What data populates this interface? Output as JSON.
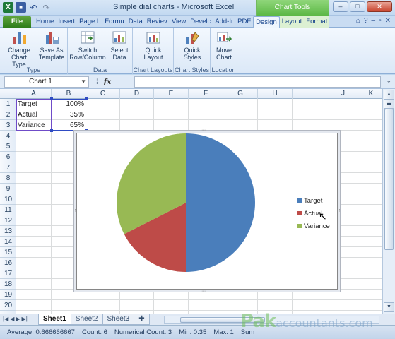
{
  "window": {
    "title": "Simple dial charts - Microsoft Excel",
    "context_tab": "Chart Tools",
    "minimize": "–",
    "maximize": "□",
    "close": "✕"
  },
  "qat": {
    "logo": "X",
    "save": "■",
    "undo": "↶",
    "redo": "↷"
  },
  "ribbon_tabs": [
    {
      "label": "File"
    },
    {
      "label": "Home"
    },
    {
      "label": "Insert"
    },
    {
      "label": "Page L"
    },
    {
      "label": "Formu"
    },
    {
      "label": "Data"
    },
    {
      "label": "Reviev"
    },
    {
      "label": "View"
    },
    {
      "label": "Develc"
    },
    {
      "label": "Add-Ir"
    },
    {
      "label": "PDF"
    },
    {
      "label": "Design"
    },
    {
      "label": "Layout"
    },
    {
      "label": "Format"
    }
  ],
  "ribbon_groups": {
    "type": {
      "label": "Type",
      "change_chart_type": "Change Chart Type",
      "save_as_template": "Save As Template"
    },
    "data": {
      "label": "Data",
      "switch_row_column": "Switch Row/Column",
      "select_data": "Select Data"
    },
    "chart_layouts": {
      "label": "Chart Layouts",
      "quick_layout": "Quick Layout"
    },
    "chart_styles": {
      "label": "Chart Styles",
      "quick_styles": "Quick Styles"
    },
    "location": {
      "label": "Location",
      "move_chart": "Move Chart"
    }
  },
  "formula_bar": {
    "name_box": "Chart 1",
    "fx": "fx",
    "formula": ""
  },
  "columns": [
    "A",
    "B",
    "C",
    "D",
    "E",
    "F",
    "G",
    "H",
    "I",
    "J",
    "K"
  ],
  "rows": [
    "1",
    "2",
    "3",
    "4",
    "5",
    "6",
    "7",
    "8",
    "9",
    "10",
    "11",
    "12",
    "13",
    "14",
    "15",
    "16",
    "17",
    "18",
    "19",
    "20"
  ],
  "cells": [
    {
      "label": "Target",
      "value": "100%"
    },
    {
      "label": "Actual",
      "value": "35%"
    },
    {
      "label": "Variance",
      "value": "65%"
    }
  ],
  "chart_data": {
    "type": "pie",
    "categories": [
      "Target",
      "Actual",
      "Variance"
    ],
    "values": [
      1.0,
      0.35,
      0.65
    ],
    "colors": [
      "#4a7ebb",
      "#be4b48",
      "#98b954"
    ],
    "legend_position": "right"
  },
  "sheets": [
    {
      "label": "Sheet1",
      "active": true
    },
    {
      "label": "Sheet2",
      "active": false
    },
    {
      "label": "Sheet3",
      "active": false
    }
  ],
  "status_bar": {
    "average": "Average: 0.666666667",
    "count": "Count: 6",
    "numerical_count": "Numerical Count: 3",
    "min": "Min: 0.35",
    "max": "Max: 1",
    "sum": "Sum"
  },
  "watermark": {
    "brand": "Pak",
    "suffix": "accountants.com"
  }
}
